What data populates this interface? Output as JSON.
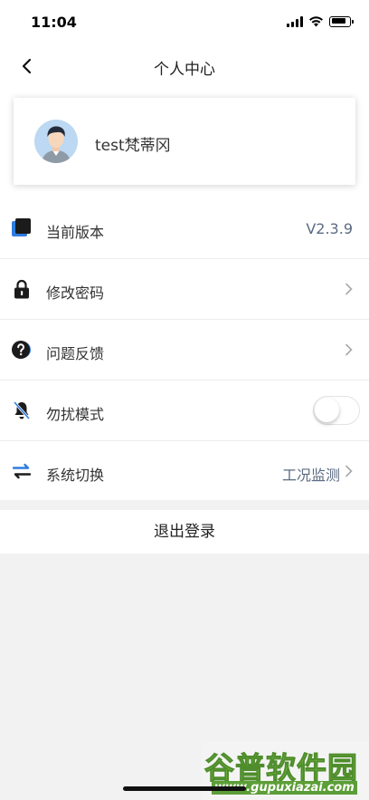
{
  "status_bar": {
    "time": "11:04"
  },
  "nav": {
    "title": "个人中心"
  },
  "profile": {
    "username": "test梵蒂冈"
  },
  "menu": {
    "version": {
      "label": "当前版本",
      "value": "V2.3.9",
      "icon": "version-square-icon"
    },
    "change_password": {
      "label": "修改密码",
      "icon": "lock-icon"
    },
    "feedback": {
      "label": "问题反馈",
      "icon": "question-icon"
    },
    "do_not_disturb": {
      "label": "勿扰模式",
      "icon": "bell-off-icon",
      "enabled": false
    },
    "system_switch": {
      "label": "系统切换",
      "value": "工况监测",
      "icon": "swap-arrows-icon"
    }
  },
  "logout": {
    "label": "退出登录"
  },
  "watermark": {
    "main": "谷普软件园",
    "sub": "www.gupuxiazai.com"
  },
  "colors": {
    "accent_blue": "#2f7de0",
    "value_text": "#5a6b82",
    "page_bg": "#f2f2f2"
  }
}
